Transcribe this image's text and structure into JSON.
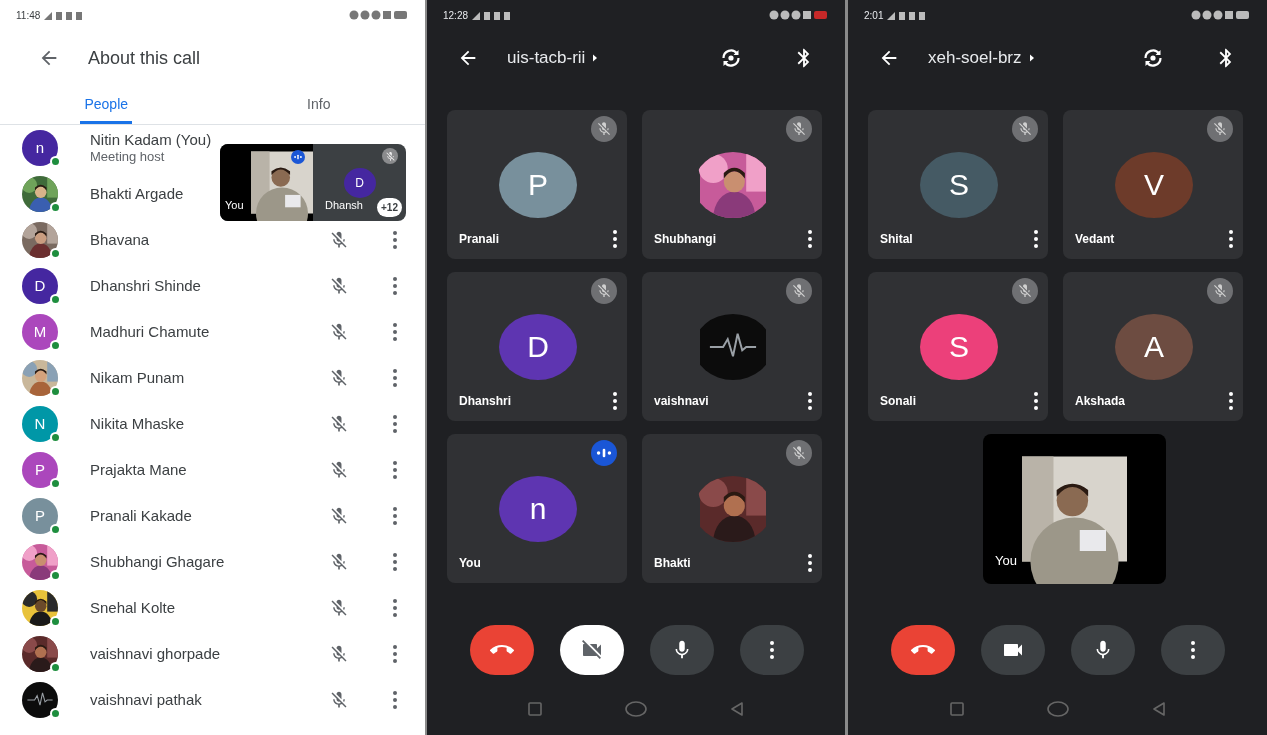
{
  "screens": [
    {
      "kind": "people",
      "status_time": "11:48",
      "title": "About this call",
      "tabs": [
        {
          "label": "People",
          "selected": true
        },
        {
          "label": "Info",
          "selected": false
        }
      ],
      "host": {
        "name": "Nitin Kadam (You)",
        "role": "Meeting host",
        "avatar": {
          "kind": "initial",
          "initial": "n",
          "color": "#4527a0"
        }
      },
      "people": [
        {
          "name": "Bhakti Argade"
        },
        {
          "name": "Bhavana",
          "muted": true
        },
        {
          "name": "Dhanshri Shinde",
          "avatar": {
            "kind": "initial",
            "initial": "D",
            "color": "#4527a0"
          },
          "muted": true
        },
        {
          "name": "Madhuri Chamute",
          "avatar": {
            "kind": "initial",
            "initial": "M",
            "color": "#ab47bc"
          },
          "muted": true
        },
        {
          "name": "Nikam Punam",
          "muted": true
        },
        {
          "name": "Nikita Mhaske",
          "avatar": {
            "kind": "initial",
            "initial": "N",
            "color": "#0097a7"
          },
          "muted": true
        },
        {
          "name": "Prajakta Mane",
          "avatar": {
            "kind": "initial",
            "initial": "P",
            "color": "#ab47bc"
          },
          "muted": true
        },
        {
          "name": "Pranali Kakade",
          "avatar": {
            "kind": "initial",
            "initial": "P",
            "color": "#78909c"
          },
          "muted": true
        },
        {
          "name": "Shubhangi Ghagare",
          "muted": true
        },
        {
          "name": "Snehal Kolte",
          "muted": true
        },
        {
          "name": "vaishnavi ghorpade",
          "muted": true
        },
        {
          "name": "vaishnavi pathak",
          "muted": true
        }
      ],
      "pip": {
        "tiles": [
          {
            "kind": "video",
            "name": "You",
            "speaking": true,
            "muted": false
          },
          {
            "kind": "initial",
            "initial": "D",
            "color": "#4527a0",
            "name": "Dhansh",
            "speaking": false,
            "muted": true
          }
        ],
        "overflow": "+12"
      }
    },
    {
      "kind": "call",
      "status_time": "12:28",
      "meeting_code": "uis-tacb-rii",
      "tiles": [
        {
          "kind": "initial",
          "initial": "P",
          "color": "#78909c",
          "name": "Pranali",
          "muted": true,
          "speaking": false,
          "menu": true
        },
        {
          "kind": "picture",
          "name": "Shubhangi",
          "muted": true,
          "speaking": false,
          "menu": true
        },
        {
          "kind": "initial",
          "initial": "D",
          "color": "#5e35b1",
          "name": "Dhanshri",
          "muted": true,
          "speaking": false,
          "menu": true
        },
        {
          "kind": "picture",
          "name": "vaishnavi",
          "muted": true,
          "speaking": false,
          "menu": true
        },
        {
          "kind": "initial",
          "initial": "n",
          "color": "#5e35b1",
          "name": "You",
          "muted": false,
          "speaking": true,
          "menu": false
        },
        {
          "kind": "picture",
          "name": "Bhakti",
          "muted": true,
          "speaking": false,
          "menu": true
        }
      ],
      "controls": [
        {
          "kind": "end"
        },
        {
          "kind": "camera",
          "on": false
        },
        {
          "kind": "mic",
          "on": true
        },
        {
          "kind": "more"
        }
      ]
    },
    {
      "kind": "call",
      "status_time": "2:01",
      "meeting_code": "xeh-soel-brz",
      "tiles": [
        {
          "kind": "initial",
          "initial": "S",
          "color": "#455a64",
          "name": "Shital",
          "muted": true,
          "speaking": false,
          "menu": true
        },
        {
          "kind": "initial",
          "initial": "V",
          "color": "#6d3b2a",
          "name": "Vedant",
          "muted": true,
          "speaking": false,
          "menu": true
        },
        {
          "kind": "initial",
          "initial": "S",
          "color": "#ec407a",
          "name": "Sonali",
          "muted": true,
          "speaking": false,
          "menu": true
        },
        {
          "kind": "initial",
          "initial": "A",
          "color": "#6d4c41",
          "name": "Akshada",
          "muted": true,
          "speaking": false,
          "menu": true
        },
        {
          "kind": "video",
          "name": "You",
          "muted": false,
          "speaking": false,
          "menu": false
        }
      ],
      "controls": [
        {
          "kind": "end"
        },
        {
          "kind": "camera",
          "on": true
        },
        {
          "kind": "mic",
          "on": true
        },
        {
          "kind": "more"
        }
      ]
    }
  ]
}
